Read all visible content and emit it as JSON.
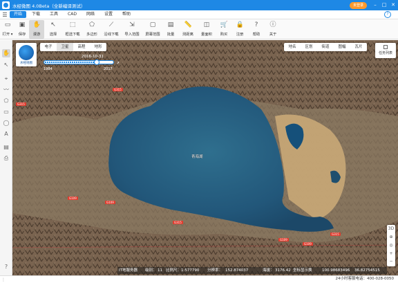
{
  "titlebar": {
    "title": "水经微图 4.0Beta（全新编译测试）",
    "login_label": "未登录"
  },
  "menubar": {
    "items": [
      {
        "label": "开始",
        "active": true
      },
      {
        "label": "下载",
        "active": false
      },
      {
        "label": "工具",
        "active": false
      },
      {
        "label": "CAD",
        "active": false
      },
      {
        "label": "网络",
        "active": false
      },
      {
        "label": "设置",
        "active": false
      },
      {
        "label": "帮助",
        "active": false
      }
    ]
  },
  "toolbar": {
    "items": [
      {
        "label": "打开 ▾",
        "icon": "open-icon"
      },
      {
        "label": "保存",
        "icon": "save-icon"
      },
      {
        "label": "漫游",
        "icon": "hand-icon",
        "active": true
      },
      {
        "label": "选择",
        "icon": "pointer-icon"
      },
      {
        "label": "框选下载",
        "icon": "box-download-icon"
      },
      {
        "label": "多边形",
        "icon": "polygon-icon"
      },
      {
        "label": "沿线下载",
        "icon": "line-download-icon"
      },
      {
        "label": "导入范围",
        "icon": "import-icon"
      },
      {
        "label": "屏幕范围",
        "icon": "screen-icon"
      },
      {
        "label": "批量",
        "icon": "batch-icon"
      },
      {
        "label": "测距离",
        "icon": "ruler-icon"
      },
      {
        "label": "量面积",
        "icon": "area-icon"
      },
      {
        "label": "购买",
        "icon": "cart-icon"
      },
      {
        "label": "注册",
        "icon": "lock-icon"
      },
      {
        "label": "帮助",
        "icon": "help-icon"
      },
      {
        "label": "关于",
        "icon": "info-icon"
      }
    ]
  },
  "map": {
    "logo_text": "水经地图",
    "source_tabs": [
      "电子",
      "卫星",
      "高程",
      "地形"
    ],
    "source_tab_selected": "卫星",
    "right_tabs": [
      "地名",
      "区划",
      "街道",
      "图幅",
      "瓦片"
    ],
    "task_list_label": "任务列表",
    "timeline": {
      "current_date": "2016-10-31",
      "start_year": "1984",
      "end_year": "2017",
      "progress": 0.78
    },
    "lake_label": "青海湖",
    "roads": [
      "G315",
      "G315",
      "G109",
      "G109",
      "G315",
      "G109",
      "G109",
      "G315"
    ]
  },
  "map_status": {
    "service": "IT地服务器",
    "level_label": "级别：",
    "level": "11",
    "scale_label": "比例尺：",
    "scale": "1:577790",
    "resolution_label": "分辨率：",
    "resolution": "152.874037",
    "elevation_label": "海拔：",
    "elevation": "3176.42",
    "unit_note": "坐标显示换",
    "longitude": "100.98683496",
    "latitude": "36.82754515"
  },
  "statusbar": {
    "hotline": "24小时客服电话：400-028-0050"
  },
  "colors": {
    "accent": "#1e88e5",
    "login": "#ff9a2e",
    "road": "#e03c2e",
    "lake": "#2a6a8a"
  }
}
